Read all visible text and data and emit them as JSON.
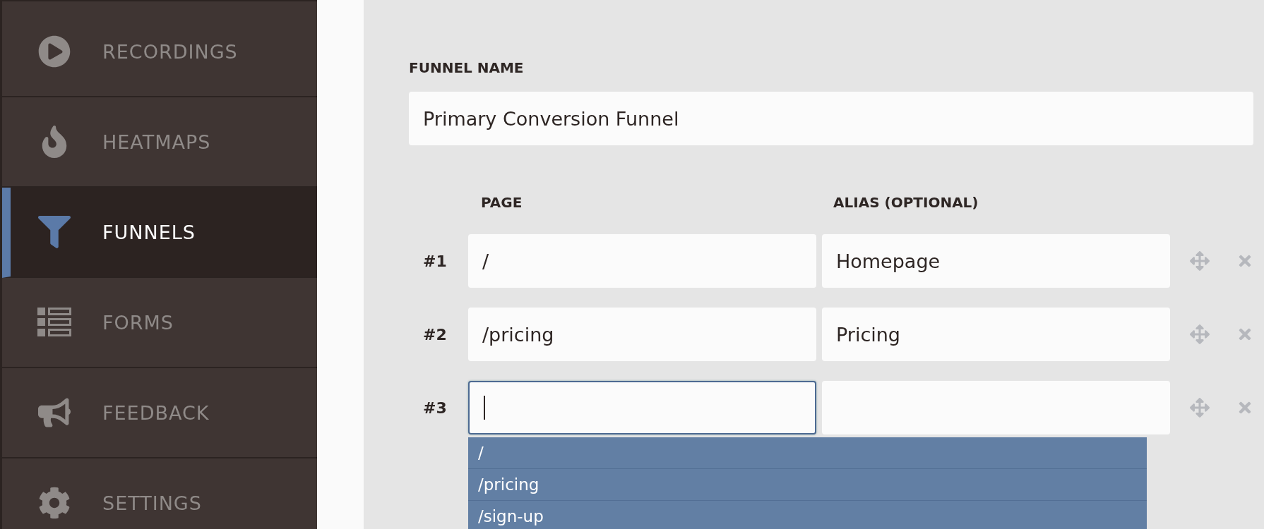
{
  "sidebar": {
    "items": [
      {
        "label": "RECORDINGS",
        "selected": false
      },
      {
        "label": "HEATMAPS",
        "selected": false
      },
      {
        "label": "FUNNELS",
        "selected": true
      },
      {
        "label": "FORMS",
        "selected": false
      },
      {
        "label": "FEEDBACK",
        "selected": false
      },
      {
        "label": "SETTINGS",
        "selected": false
      }
    ]
  },
  "funnel_name": {
    "label": "FUNNEL NAME",
    "value": "Primary Conversion Funnel"
  },
  "steps": {
    "columns": [
      "PAGE",
      "ALIAS (OPTIONAL)"
    ],
    "rows": [
      {
        "number": "#1",
        "page": "/",
        "alias": "Homepage",
        "focused": false
      },
      {
        "number": "#2",
        "page": "/pricing",
        "alias": "Pricing",
        "focused": false
      },
      {
        "number": "#3",
        "page": "",
        "alias": "",
        "focused": true
      }
    ]
  },
  "suggestions": [
    "/",
    "/pricing",
    "/sign-up"
  ]
}
